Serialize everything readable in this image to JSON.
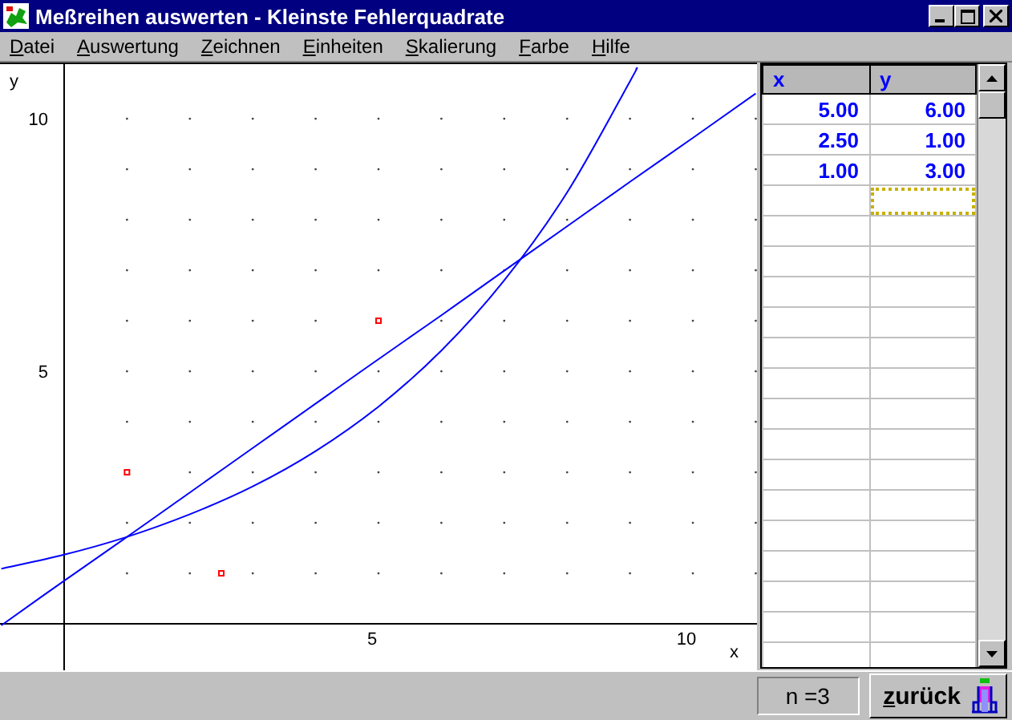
{
  "window": {
    "title": "Meßreihen auswerten - Kleinste Fehlerquadrate"
  },
  "menu": [
    "Datei",
    "Auswertung",
    "Zeichnen",
    "Einheiten",
    "Skalierung",
    "Farbe",
    "Hilfe"
  ],
  "plot": {
    "chart_data": {
      "type": "scatter",
      "xlabel": "x",
      "ylabel": "y",
      "xlim": [
        -1.02,
        11.02
      ],
      "ylim": [
        -0.92,
        11.08
      ],
      "xticks": [
        5,
        10
      ],
      "yticks": [
        5,
        10
      ],
      "series": [
        {
          "type": "scatter",
          "color": "#ff0000",
          "x": [
            5,
            2.5,
            1
          ],
          "values": [
            6,
            1,
            3
          ]
        },
        {
          "type": "line",
          "color": "#0000ff",
          "x": [
            -1,
            0,
            1,
            2,
            3,
            4,
            5,
            6,
            7,
            8,
            9,
            10,
            11
          ],
          "values": [
            -0.03,
            0.85,
            1.72,
            2.6,
            3.48,
            4.36,
            5.24,
            6.11,
            6.99,
            7.87,
            8.75,
            9.62,
            10.5
          ]
        },
        {
          "type": "line",
          "color": "#0000ff",
          "x": [
            -1,
            0,
            1,
            2,
            3,
            4,
            5,
            6,
            7,
            8,
            9,
            9.1
          ],
          "values": [
            1.09,
            1.37,
            1.72,
            2.17,
            2.72,
            3.42,
            4.3,
            5.41,
            6.8,
            8.54,
            10.74,
            10.99
          ]
        }
      ]
    }
  },
  "table": {
    "columns": [
      "x",
      "y"
    ],
    "rows": [
      [
        "5.00",
        "6.00"
      ],
      [
        "2.50",
        "1.00"
      ],
      [
        "1.00",
        "3.00"
      ]
    ],
    "entry_row": {
      "cells": [
        {
          "focused": false
        },
        {
          "focused": true
        }
      ]
    }
  },
  "status_bar": {
    "count": "n =3",
    "back_button": "zurück"
  }
}
